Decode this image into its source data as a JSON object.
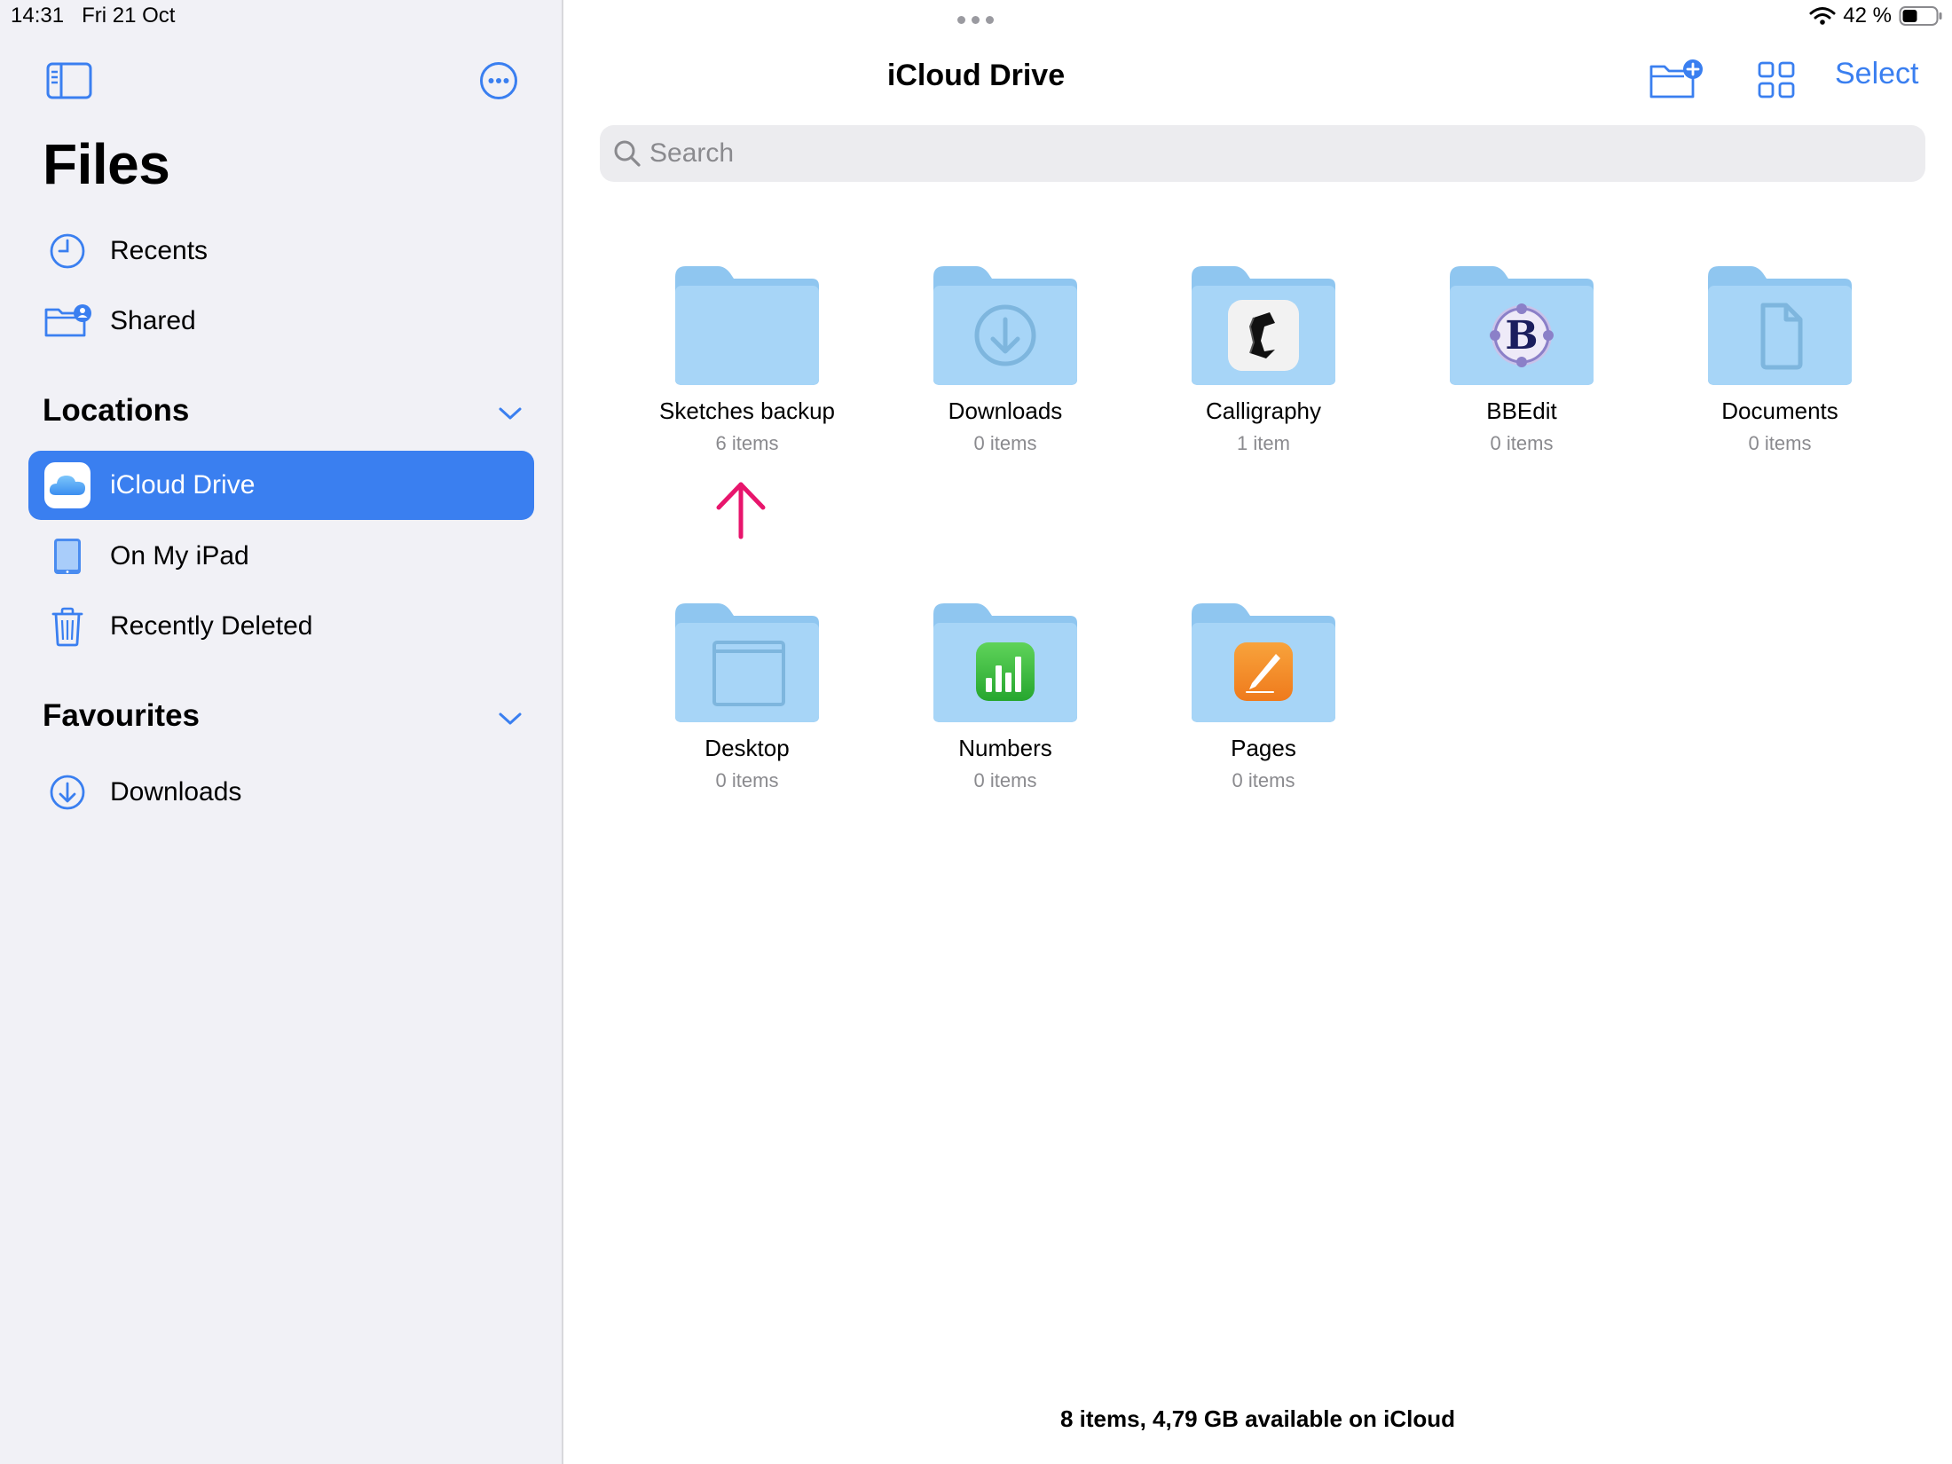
{
  "status_bar": {
    "time": "14:31",
    "date": "Fri 21 Oct",
    "battery": "42 %"
  },
  "sidebar": {
    "title": "Files",
    "items": [
      {
        "label": "Recents",
        "icon": "clock-icon"
      },
      {
        "label": "Shared",
        "icon": "shared-folder-icon"
      }
    ],
    "locations": {
      "title": "Locations",
      "items": [
        {
          "label": "iCloud Drive",
          "icon": "icloud-icon",
          "selected": true
        },
        {
          "label": "On My iPad",
          "icon": "ipad-icon"
        },
        {
          "label": "Recently Deleted",
          "icon": "trash-icon"
        }
      ]
    },
    "favourites": {
      "title": "Favourites",
      "items": [
        {
          "label": "Downloads",
          "icon": "download-circle-icon"
        }
      ]
    }
  },
  "main": {
    "title": "iCloud Drive",
    "select_label": "Select",
    "search": {
      "placeholder": "Search"
    },
    "folders": [
      {
        "name": "Sketches backup",
        "count": "6 items",
        "badge": "none"
      },
      {
        "name": "Downloads",
        "count": "0 items",
        "badge": "download-circle-icon"
      },
      {
        "name": "Calligraphy",
        "count": "1 item",
        "badge": "calligraphy-app-icon"
      },
      {
        "name": "BBEdit",
        "count": "0 items",
        "badge": "bbedit-app-icon"
      },
      {
        "name": "Documents",
        "count": "0 items",
        "badge": "document-icon"
      },
      {
        "name": "Desktop",
        "count": "0 items",
        "badge": "desktop-window-icon"
      },
      {
        "name": "Numbers",
        "count": "0 items",
        "badge": "numbers-app-icon"
      },
      {
        "name": "Pages",
        "count": "0 items",
        "badge": "pages-app-icon"
      }
    ],
    "footer": "8 items, 4,79 GB available on iCloud"
  },
  "colors": {
    "accent": "#3a7ff0",
    "folder_light": "#a7d5f7",
    "folder_dark": "#8fc6f0",
    "annotation_arrow": "#e8156c"
  }
}
